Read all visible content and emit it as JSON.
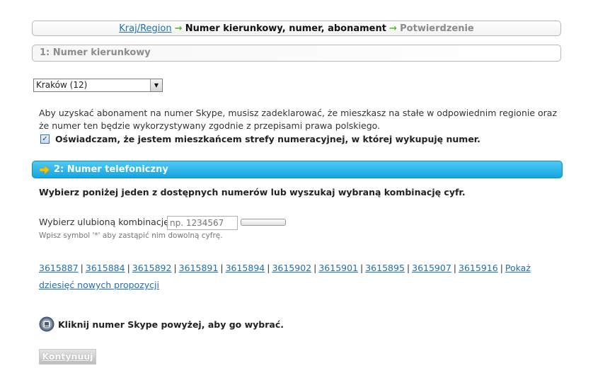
{
  "breadcrumb": {
    "step1": "Kraj/Region",
    "arrow": "→",
    "step2": "Numer kierunkowy, numer, abonament",
    "step3": "Potwierdzenie"
  },
  "section1": {
    "title": "1: Numer kierunkowy",
    "region_select": {
      "selected": "Kraków (12)"
    },
    "notice": "Aby uzyskać abonament na numer Skype, musisz zadeklarować, że mieszkasz na stałe w odpowiednim regionie oraz że numer ten będzie wykorzystywany zgodnie z przepisami prawa polskiego.",
    "declaration": "Oświadczam, że jestem mieszkańcem strefy numeracyjnej, w której wykupuję numer.",
    "declaration_checked": true
  },
  "section2": {
    "title": "2: Numer telefoniczny",
    "instruction": "Wybierz poniżej jeden z dostępnych numerów lub wyszukaj wybraną kombinację cyfr.",
    "combo_label": "Wybierz ulubioną kombinację:",
    "combo_placeholder": "np. 1234567",
    "hint": "Wpisz symbol '*' aby zastąpić nim dowolną cyfrę.",
    "numbers": [
      "3615887",
      "3615884",
      "3615892",
      "3615891",
      "3615894",
      "3615902",
      "3615901",
      "3615895",
      "3615907",
      "3615916"
    ],
    "separator": "|",
    "more_link": "Pokaż dziesięć nowych propozycji",
    "click_note": "Kliknij numer Skype powyżej, aby go wybrać."
  },
  "continue_label": "Kontynuuj",
  "colors": {
    "link": "#1f6fb7",
    "header_blue": "#16a5e0",
    "arrow_green": "#5cb82e",
    "arrow_yellow": "#f5c400"
  },
  "icons": {
    "header_arrow": "arrow-right-icon",
    "skype": "skype-phone-icon",
    "select": "chevron-down-icon"
  }
}
